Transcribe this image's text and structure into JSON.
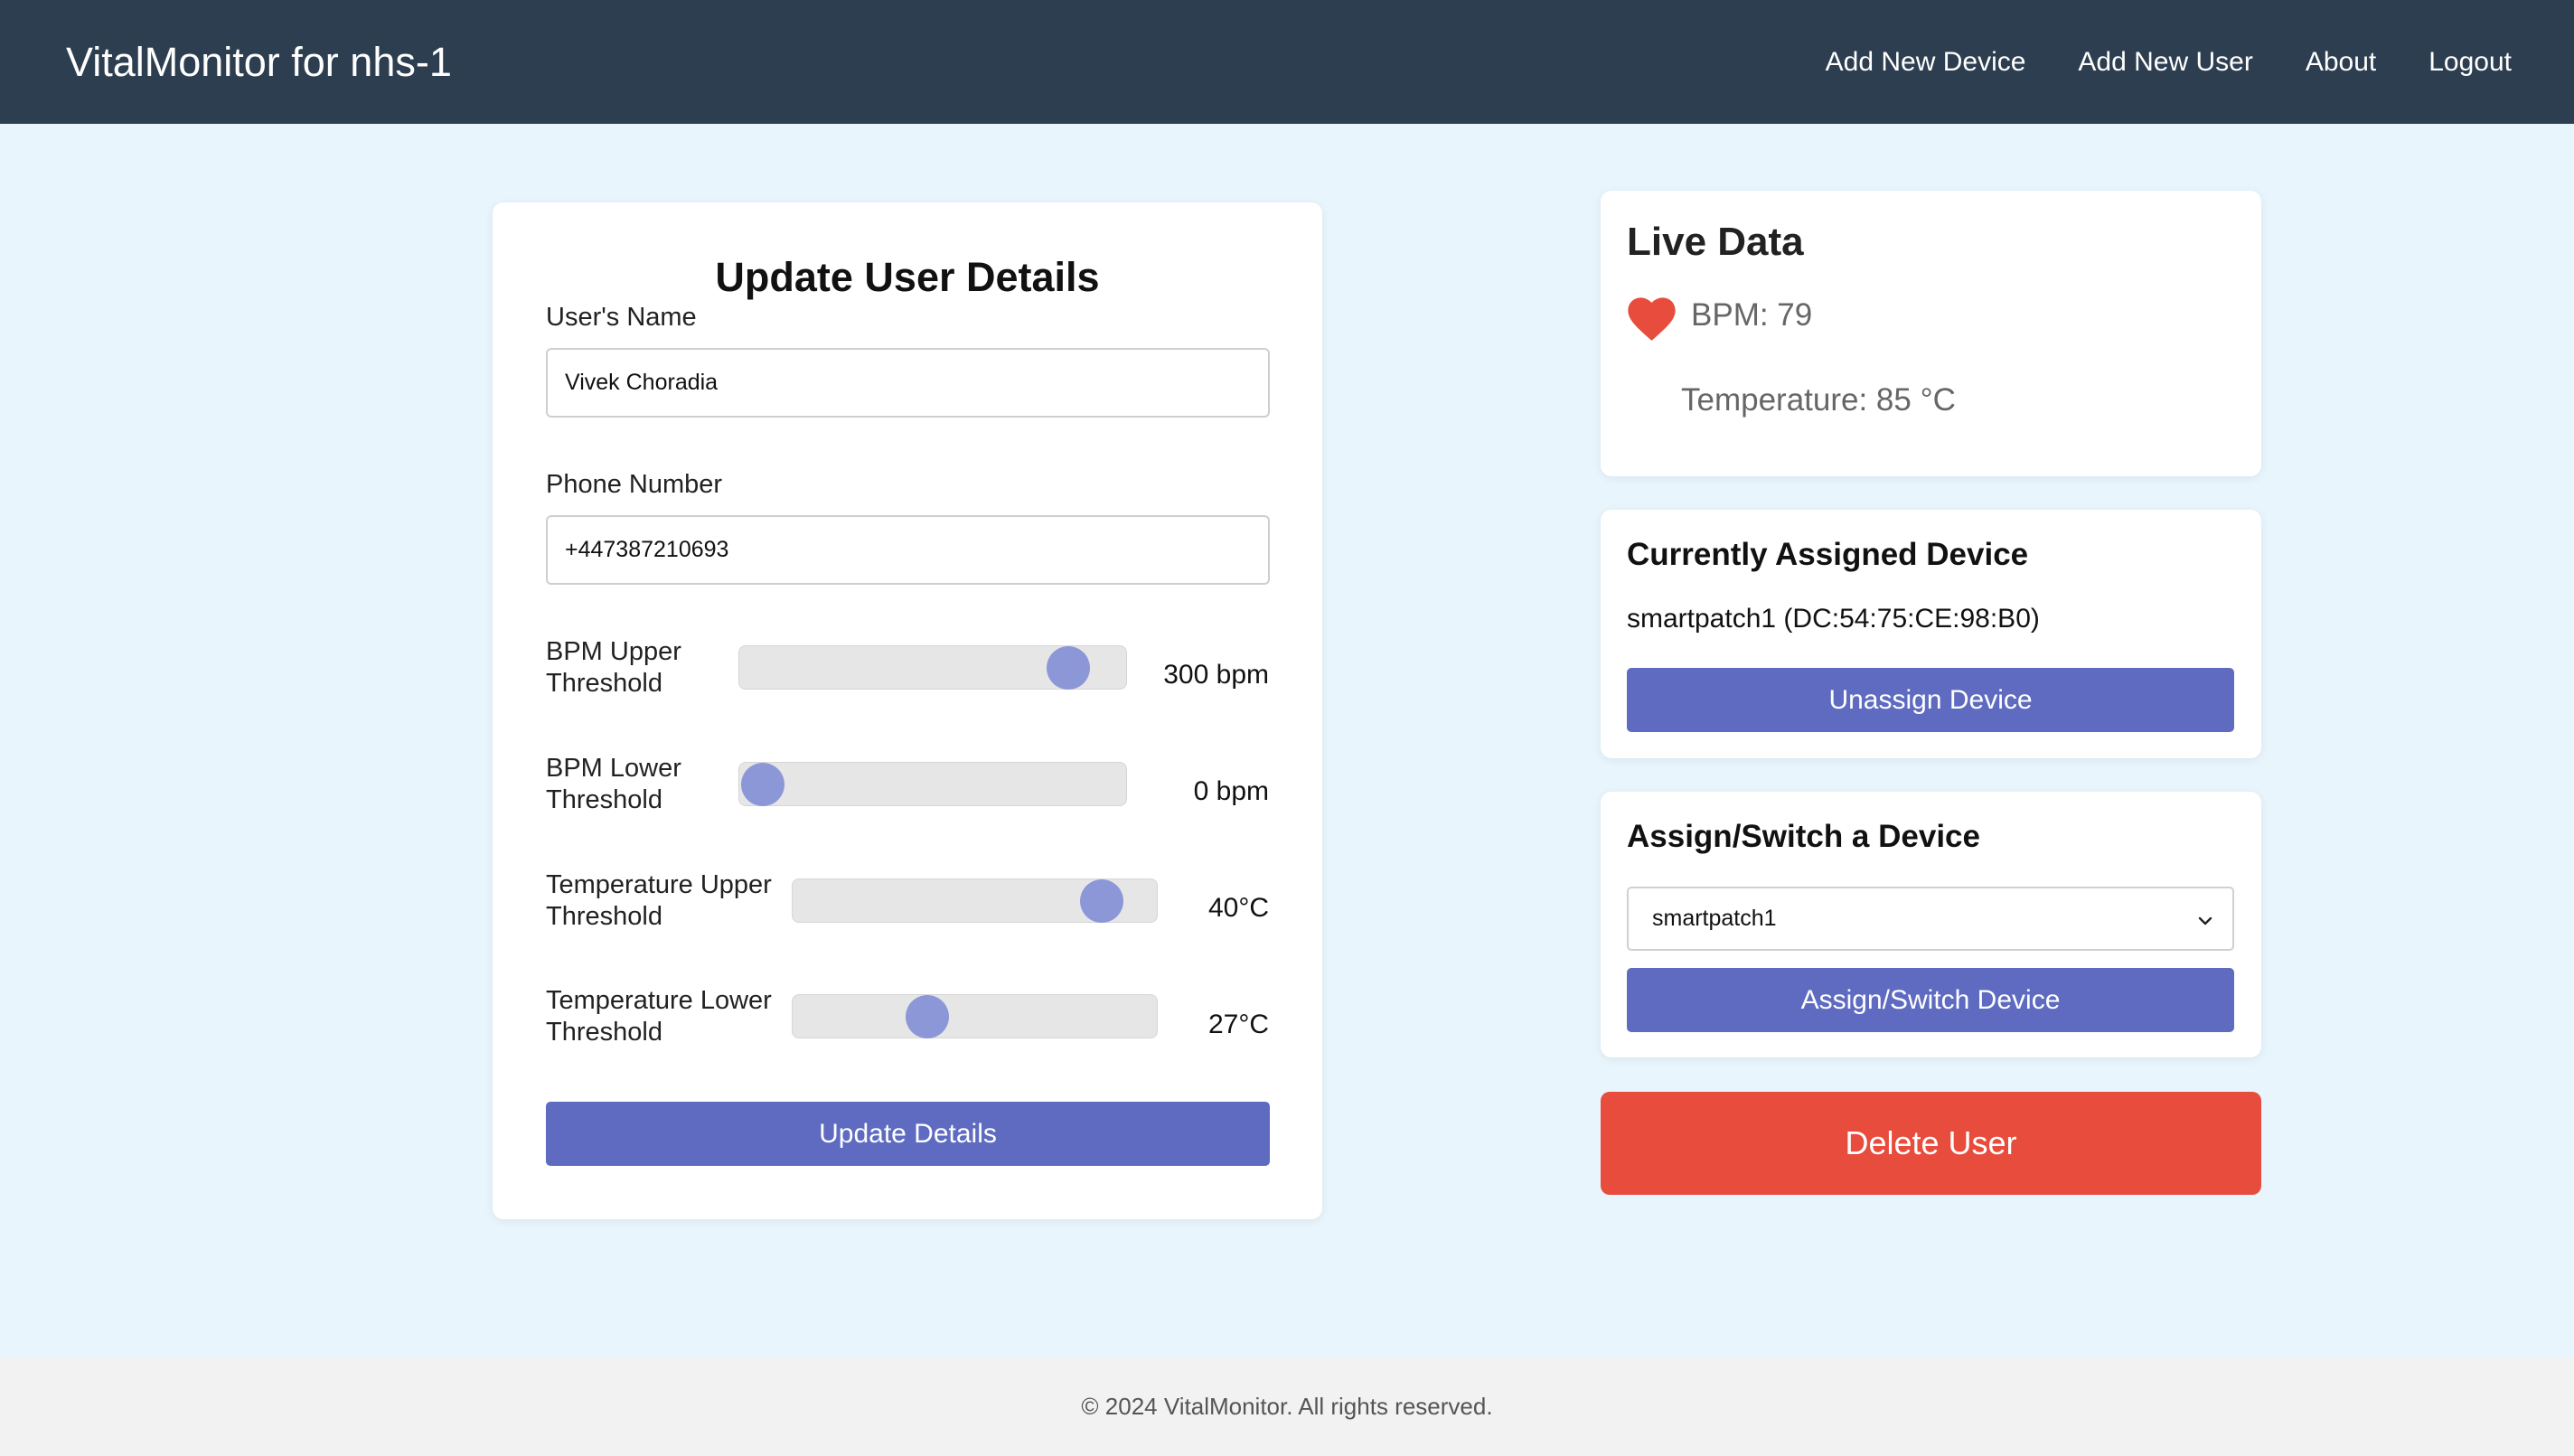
{
  "header": {
    "brand": "VitalMonitor for nhs-1",
    "nav": [
      {
        "label": "Add New Device"
      },
      {
        "label": "Add New User"
      },
      {
        "label": "About"
      },
      {
        "label": "Logout"
      }
    ]
  },
  "update_form": {
    "title": "Update User Details",
    "name_label": "User's Name",
    "name_value": "Vivek Choradia",
    "phone_label": "Phone Number",
    "phone_value": "+447387210693",
    "sliders": [
      {
        "label_line1": "BPM Upper",
        "label_line2": "Threshold",
        "value_text": "300 bpm",
        "level": 0.9
      },
      {
        "label_line1": "BPM Lower",
        "label_line2": "Threshold",
        "value_text": "0 bpm",
        "level": 0.0
      },
      {
        "label_line1": "Temperature Upper",
        "label_line2": "Threshold",
        "value_text": "40°C",
        "level": 0.9
      },
      {
        "label_line1": "Temperature Lower",
        "label_line2": "Threshold",
        "value_text": "27°C",
        "level": 0.35
      }
    ],
    "submit_label": "Update Details"
  },
  "live_data": {
    "title": "Live Data",
    "bpm_text": "BPM: 79",
    "temperature_text": "Temperature: 85 °C",
    "heart_color": "#e74c3c"
  },
  "assigned_device": {
    "title": "Currently Assigned Device",
    "device_text": "smartpatch1 (DC:54:75:CE:98:B0)",
    "unassign_label": "Unassign Device"
  },
  "assign_switch": {
    "title": "Assign/Switch a Device",
    "selected_device": "smartpatch1",
    "button_label": "Assign/Switch Device"
  },
  "delete_label": "Delete User",
  "footer": {
    "text": "© 2024 VitalMonitor. All rights reserved."
  },
  "colors": {
    "header_bg": "#2d3e50",
    "page_bg": "#e8f5fd",
    "primary": "#5e6bc0",
    "slider_thumb": "#8c97d8",
    "danger": "#e74c3d"
  }
}
